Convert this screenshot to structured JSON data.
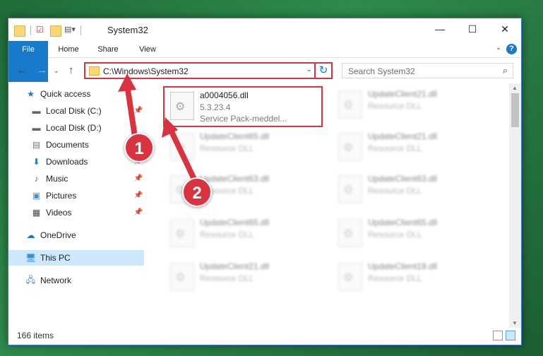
{
  "window": {
    "title": "System32"
  },
  "ribbon": {
    "tabs": [
      "File",
      "Home",
      "Share",
      "View"
    ],
    "help": "?"
  },
  "address": {
    "path": "C:\\Windows\\System32"
  },
  "search": {
    "placeholder": "Search System32"
  },
  "nav": {
    "items": [
      {
        "label": "Quick access",
        "icon": "star-icon"
      },
      {
        "label": "Local Disk (C:)",
        "icon": "drive-icon"
      },
      {
        "label": "Local Disk (D:)",
        "icon": "drive-icon"
      },
      {
        "label": "Documents",
        "icon": "documents-icon"
      },
      {
        "label": "Downloads",
        "icon": "download-icon"
      },
      {
        "label": "Music",
        "icon": "music-icon"
      },
      {
        "label": "Pictures",
        "icon": "pictures-icon"
      },
      {
        "label": "Videos",
        "icon": "videos-icon"
      },
      {
        "label": "OneDrive",
        "icon": "cloud-icon"
      },
      {
        "label": "This PC",
        "icon": "computer-icon"
      },
      {
        "label": "Network",
        "icon": "network-icon"
      }
    ]
  },
  "files": {
    "featured": {
      "name": "a0004056.dll",
      "version": "5.3.23.4",
      "description": "Service Pack-meddel..."
    },
    "blurred": [
      {
        "name": "UpdateClient65.dll",
        "desc": "Resource DLL"
      },
      {
        "name": "UpdateClient63.dll",
        "desc": "Resource DLL"
      },
      {
        "name": "UpdateClient65.dll",
        "desc": "Resource DLL"
      },
      {
        "name": "UpdateClient21.dll",
        "desc": "Resource DLL"
      },
      {
        "name": "UpdateClient21.dll",
        "desc": "Resource DLL"
      },
      {
        "name": "UpdateClient21.dll",
        "desc": "Resource DLL"
      },
      {
        "name": "UpdateClient63.dll",
        "desc": "Resource DLL"
      },
      {
        "name": "UpdateClient65.dll",
        "desc": "Resource DLL"
      },
      {
        "name": "UpdateClient19.dll",
        "desc": "Resource DLL"
      }
    ]
  },
  "status": {
    "count": "166 items"
  },
  "annotations": {
    "step1": "1",
    "step2": "2",
    "color": "#d9333f"
  }
}
